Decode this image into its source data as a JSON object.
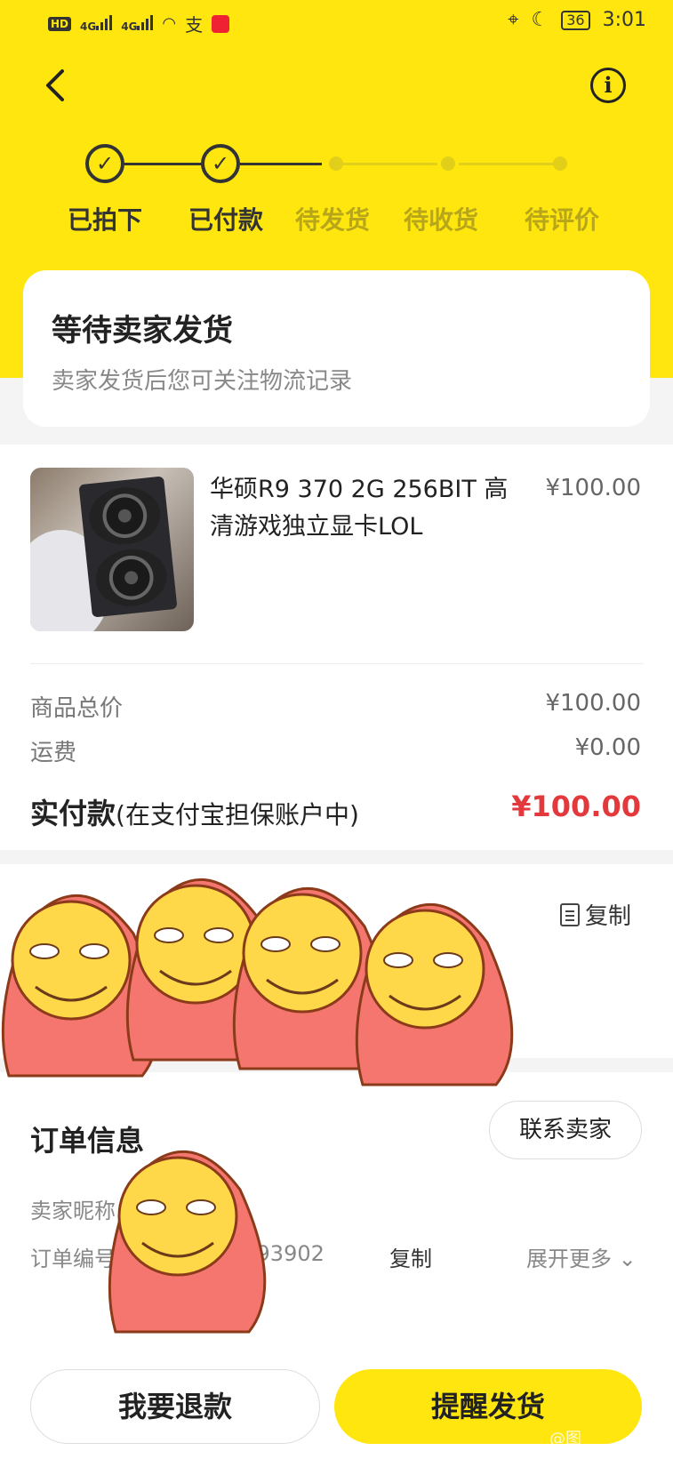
{
  "status_bar": {
    "left_icons": [
      "hd-icon",
      "4g-signal-icon",
      "4g-signal-icon",
      "wifi-icon",
      "alipay-icon",
      "reader-app-icon"
    ],
    "battery": "36",
    "time": "3:01"
  },
  "steps": [
    {
      "label": "已拍下",
      "state": "done"
    },
    {
      "label": "已付款",
      "state": "done"
    },
    {
      "label": "待发货",
      "state": "pending"
    },
    {
      "label": "待收货",
      "state": "pending"
    },
    {
      "label": "待评价",
      "state": "pending"
    }
  ],
  "status_card": {
    "title": "等待卖家发货",
    "subtitle": "卖家发货后您可关注物流记录"
  },
  "product": {
    "title": "华硕R9 370 2G 256BIT 高清游戏独立显卡LOL",
    "price": "¥100.00"
  },
  "fees": {
    "goods_total_label": "商品总价",
    "goods_total_value": "¥100.00",
    "shipping_label": "运费",
    "shipping_value": "¥0.00",
    "paid_label": "实付款",
    "paid_note": "(在支付宝担保账户中)",
    "paid_value": "¥100.00"
  },
  "address": {
    "copy_label": "复制"
  },
  "order_info": {
    "title": "订单信息",
    "contact_button": "联系卖家",
    "seller_label": "卖家昵称",
    "order_no_label": "订单编号",
    "order_no_value": "5993902",
    "copy_label": "复制",
    "expand_label": "展开更多"
  },
  "actions": {
    "refund": "我要退款",
    "remind": "提醒发货"
  },
  "watermark": "@图",
  "colors": {
    "brand_yellow": "#ffe60f",
    "price_red": "#e4393c"
  }
}
